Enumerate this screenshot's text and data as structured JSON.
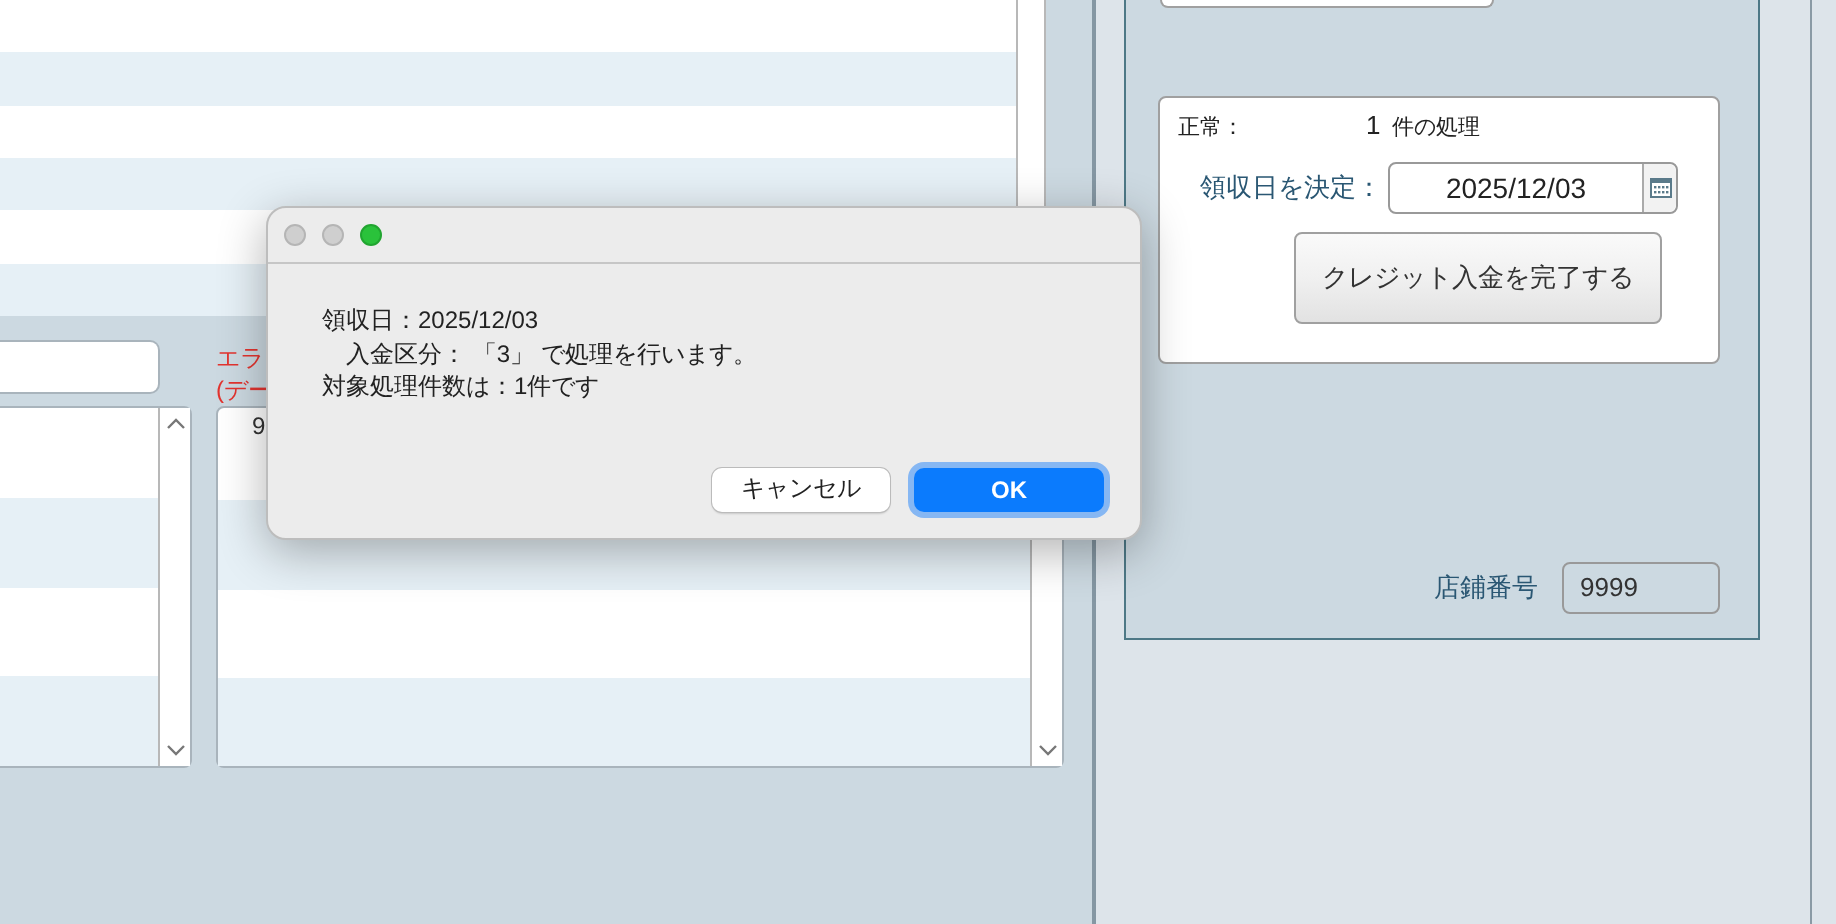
{
  "error_label": {
    "lines": [
      "エラ",
      "(デー"
    ]
  },
  "detail_list": {
    "cells": [
      "9"
    ]
  },
  "summary_card": {
    "normal_label": "正常：",
    "count": "1",
    "count_suffix": "件の処理",
    "date_label": "領収日を決定：",
    "date_value": "2025/12/03",
    "complete_button": "クレジット入金を完了する"
  },
  "store": {
    "label": "店鋪番号",
    "value": "9999"
  },
  "dialog": {
    "traffic_lights": [
      {
        "active": false
      },
      {
        "active": false
      },
      {
        "active": true
      }
    ],
    "lines": [
      "領収日：2025/12/03",
      "　入金区分： 「3」 で処理を行います。",
      "対象処理件数は：1件です"
    ],
    "buttons": [
      {
        "label": "キャンセル",
        "default": false
      },
      {
        "label": "OK",
        "default": true
      }
    ]
  }
}
